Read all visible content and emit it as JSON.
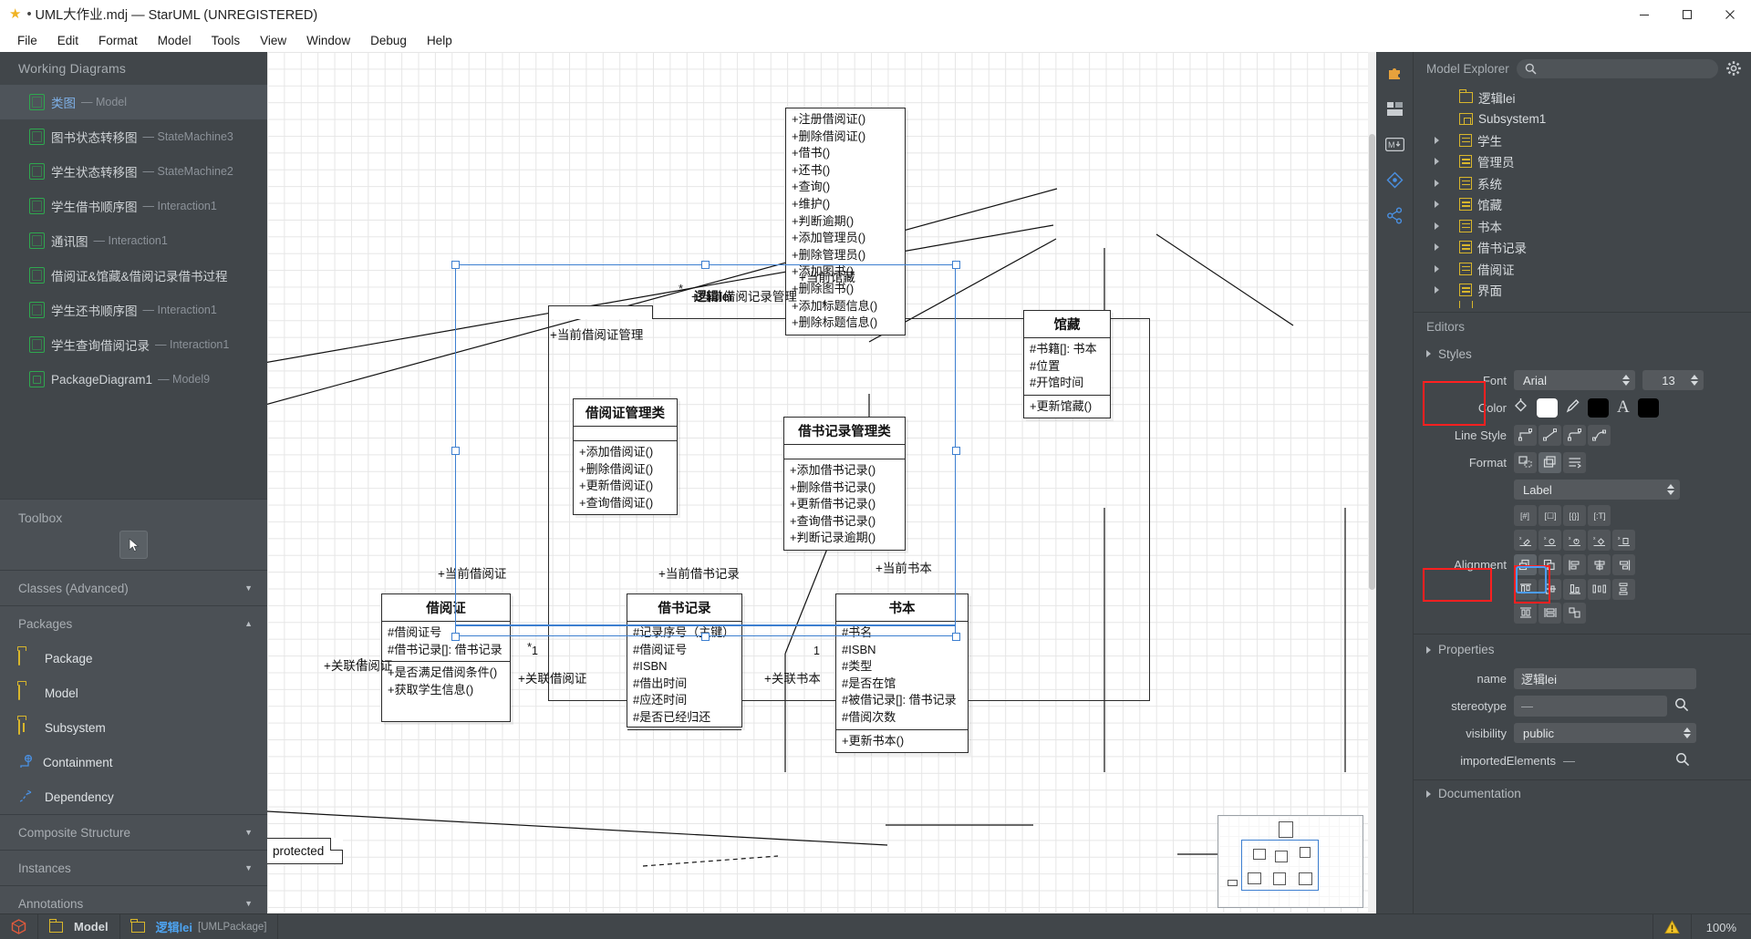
{
  "titlebar": {
    "star_icon": "star-icon",
    "dot": "•",
    "title": "UML大作业.mdj — StarUML (UNREGISTERED)",
    "minimize": "—",
    "maximize": "❐",
    "close": "✕"
  },
  "menubar": {
    "items": [
      "File",
      "Edit",
      "Format",
      "Model",
      "Tools",
      "View",
      "Window",
      "Debug",
      "Help"
    ]
  },
  "left_panel": {
    "working_diagrams_title": "Working Diagrams",
    "diagrams": [
      {
        "name": "类图",
        "type": "Model",
        "selected": true
      },
      {
        "name": "图书状态转移图",
        "type": "StateMachine3",
        "selected": false
      },
      {
        "name": "学生状态转移图",
        "type": "StateMachine2",
        "selected": false
      },
      {
        "name": "学生借书顺序图",
        "type": "Interaction1",
        "selected": false
      },
      {
        "name": "通讯图",
        "type": "Interaction1",
        "selected": false
      },
      {
        "name": "借阅证&馆藏&借阅记录借书过程",
        "type": "",
        "selected": false
      },
      {
        "name": "学生还书顺序图",
        "type": "Interaction1",
        "selected": false
      },
      {
        "name": "学生查询借阅记录",
        "type": "Interaction1",
        "selected": false
      },
      {
        "name": "PackageDiagram1",
        "type": "Model9",
        "selected": false
      }
    ],
    "toolbox_title": "Toolbox",
    "cursor_tool_icon": "cursor-arrow-icon",
    "sections": [
      {
        "label": "Classes (Advanced)",
        "collapsed": true
      },
      {
        "label": "Packages",
        "collapsed": false
      }
    ],
    "tools": [
      {
        "label": "Package",
        "icon": "package-folder-icon"
      },
      {
        "label": "Model",
        "icon": "model-folder-icon"
      },
      {
        "label": "Subsystem",
        "icon": "subsystem-folder-icon"
      },
      {
        "label": "Containment",
        "icon": "containment-icon"
      },
      {
        "label": "Dependency",
        "icon": "dependency-icon"
      }
    ],
    "sections2": [
      {
        "label": "Composite Structure",
        "collapsed": true
      },
      {
        "label": "Instances",
        "collapsed": true
      },
      {
        "label": "Annotations",
        "collapsed": true
      }
    ]
  },
  "diagram": {
    "classes": [
      {
        "name": "",
        "attrs": [],
        "ops": [
          "+注册借阅证()",
          "+删除借阅证()",
          "+借书()",
          "+还书()",
          "+查询()",
          "+维护()",
          "+判断逾期()",
          "+添加管理员()",
          "+删除管理员()",
          "+添加图书()",
          "+删除图书()",
          "+添加标题信息()",
          "+删除标题信息()"
        ]
      },
      {
        "name": "借阅证管理类",
        "attrs": [],
        "ops": [
          "+添加借阅证()",
          "+删除借阅证()",
          "+更新借阅证()",
          "+查询借阅证()"
        ]
      },
      {
        "name": "借书记录管理类",
        "attrs": [],
        "ops": [
          "+添加借书记录()",
          "+删除借书记录()",
          "+更新借书记录()",
          "+查询借书记录()",
          "+判断记录逾期()"
        ]
      },
      {
        "name": "馆藏",
        "attrs": [
          "#书籍[]: 书本",
          "#位置",
          "#开馆时间"
        ],
        "ops": [
          "+更新馆藏()"
        ]
      },
      {
        "name": "借阅证",
        "attrs": [
          "#借阅证号",
          "#借书记录[]: 借书记录"
        ],
        "ops": [
          "+是否满足借阅条件()",
          "+获取学生信息()"
        ]
      },
      {
        "name": "借书记录",
        "attrs": [
          "#记录序号（主键）",
          "#借阅证号",
          "#ISBN",
          "#借出时间",
          "#应还时间",
          "#是否已经归还"
        ],
        "ops": []
      },
      {
        "name": "书本",
        "attrs": [
          "#书名",
          "#ISBN",
          "#类型",
          "#是否在馆",
          "#被借记录[]: 借书记录",
          "#借阅次数"
        ],
        "ops": [
          "+更新书本()"
        ]
      }
    ],
    "labels": {
      "current_card_mgmt": "+当前借阅证管理",
      "current_record_mgmt": "+当前借阅记录管理",
      "package_name_overlay": "逻辑lei",
      "current_stock": "+当前馆藏",
      "current_card": "+当前借阅证",
      "current_borrow_record": "+当前借书记录",
      "current_book": "+当前书本",
      "assoc_card": "+关联借阅证",
      "assoc_card2": "+关联借阅证",
      "assoc_book": "+关联书本",
      "note_text": "protected",
      "mult_star": "*",
      "mult_one": "1"
    }
  },
  "rail": {
    "buttons": [
      {
        "icon": "extension-puzzle-icon"
      },
      {
        "icon": "panels-grid-icon"
      },
      {
        "icon": "markdown-icon",
        "label": "M↓"
      },
      {
        "icon": "diamond-node-icon"
      },
      {
        "icon": "share-network-icon"
      }
    ]
  },
  "right_panel": {
    "model_explorer": {
      "title": "Model Explorer",
      "search_icon": "search-icon",
      "search_placeholder": "",
      "gear_icon": "gear-icon",
      "items": [
        {
          "label": "逻辑lei",
          "icon": "folder-icon",
          "twisty": false,
          "indent": 1
        },
        {
          "label": "Subsystem1",
          "icon": "subsystem-icon",
          "twisty": false,
          "indent": 1
        },
        {
          "label": "学生",
          "icon": "class-icon",
          "twisty": true,
          "indent": 1
        },
        {
          "label": "管理员",
          "icon": "class-icon",
          "twisty": true,
          "indent": 1
        },
        {
          "label": "系统",
          "icon": "class-icon",
          "twisty": true,
          "indent": 1
        },
        {
          "label": "馆藏",
          "icon": "class-icon",
          "twisty": true,
          "indent": 1
        },
        {
          "label": "书本",
          "icon": "class-icon",
          "twisty": true,
          "indent": 1
        },
        {
          "label": "借书记录",
          "icon": "class-icon",
          "twisty": true,
          "indent": 1
        },
        {
          "label": "借阅证",
          "icon": "class-icon",
          "twisty": true,
          "indent": 1
        },
        {
          "label": "界面",
          "icon": "class-icon",
          "twisty": true,
          "indent": 1
        }
      ]
    },
    "editors": {
      "title": "Editors",
      "styles_label": "Styles",
      "font_label": "Font",
      "font_value": "Arial",
      "font_size": "13",
      "color_label": "Color",
      "color_fill": "#ffffff",
      "color_line": "#000000",
      "color_text": "#000000",
      "line_style_label": "Line Style",
      "format_label": "Format",
      "label_select": "Label",
      "alignment_label": "Alignment"
    },
    "properties": {
      "title": "Properties",
      "name_label": "name",
      "name_value": "逻辑lei",
      "stereotype_label": "stereotype",
      "stereotype_value": "—",
      "visibility_label": "visibility",
      "visibility_value": "public",
      "imported_label": "importedElements",
      "imported_value": "—",
      "documentation_title": "Documentation"
    }
  },
  "statusbar": {
    "cube_icon": "cube-icon",
    "model_label": "Model",
    "package_label": "逻辑lei",
    "package_type": "[UMLPackage]",
    "warning_icon": "warning-icon",
    "zoom": "100%"
  }
}
